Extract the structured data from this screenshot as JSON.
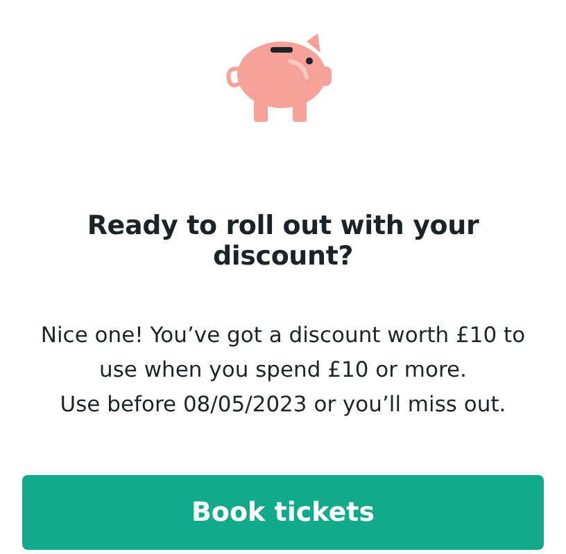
{
  "title": "Ready to roll out with your discount?",
  "paragraphs": [
    "Nice one! You’ve got a discount worth £10 to use when you spend £10 or more.",
    "Use before 08/05/2023 or you’ll miss out."
  ],
  "button": {
    "label": "Book tickets"
  }
}
